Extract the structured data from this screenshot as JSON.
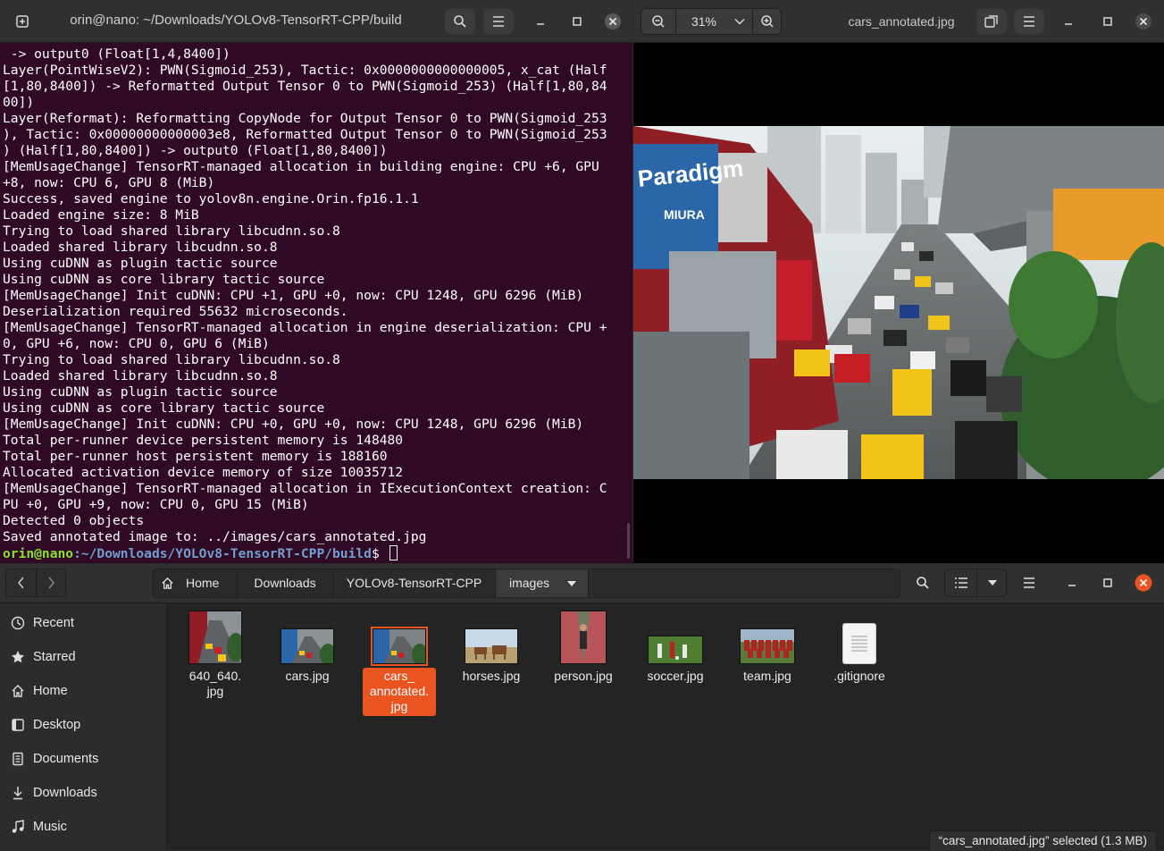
{
  "terminal": {
    "title": "orin@nano: ~/Downloads/YOLOv8-TensorRT-CPP/build",
    "lines": [
      " -> output0 (Float[1,4,8400])",
      "Layer(PointWiseV2): PWN(Sigmoid_253), Tactic: 0x0000000000000005, x_cat (Half",
      "[1,80,8400]) -> Reformatted Output Tensor 0 to PWN(Sigmoid_253) (Half[1,80,84",
      "00])",
      "Layer(Reformat): Reformatting CopyNode for Output Tensor 0 to PWN(Sigmoid_253",
      "), Tactic: 0x00000000000003e8, Reformatted Output Tensor 0 to PWN(Sigmoid_253",
      ") (Half[1,80,8400]) -> output0 (Float[1,80,8400])",
      "[MemUsageChange] TensorRT-managed allocation in building engine: CPU +6, GPU",
      "+8, now: CPU 6, GPU 8 (MiB)",
      "Success, saved engine to yolov8n.engine.Orin.fp16.1.1",
      "Loaded engine size: 8 MiB",
      "Trying to load shared library libcudnn.so.8",
      "Loaded shared library libcudnn.so.8",
      "Using cuDNN as plugin tactic source",
      "Using cuDNN as core library tactic source",
      "[MemUsageChange] Init cuDNN: CPU +1, GPU +0, now: CPU 1248, GPU 6296 (MiB)",
      "Deserialization required 55632 microseconds.",
      "[MemUsageChange] TensorRT-managed allocation in engine deserialization: CPU +",
      "0, GPU +6, now: CPU 0, GPU 6 (MiB)",
      "Trying to load shared library libcudnn.so.8",
      "Loaded shared library libcudnn.so.8",
      "Using cuDNN as plugin tactic source",
      "Using cuDNN as core library tactic source",
      "[MemUsageChange] Init cuDNN: CPU +0, GPU +0, now: CPU 1248, GPU 6296 (MiB)",
      "Total per-runner device persistent memory is 148480",
      "Total per-runner host persistent memory is 188160",
      "Allocated activation device memory of size 10035712",
      "[MemUsageChange] TensorRT-managed allocation in IExecutionContext creation: C",
      "PU +0, GPU +9, now: CPU 0, GPU 15 (MiB)",
      "Detected 0 objects",
      "Saved annotated image to: ../images/cars_annotated.jpg"
    ],
    "prompt_user": "orin@nano",
    "prompt_path": ":~/Downloads/YOLOv8-TensorRT-CPP/build",
    "prompt_symbol": "$ "
  },
  "viewer": {
    "zoom": "31%",
    "title": "cars_annotated.jpg"
  },
  "files": {
    "breadcrumbs": [
      "Home",
      "Downloads",
      "YOLOv8-TensorRT-CPP",
      "images"
    ],
    "sidebar": [
      "Recent",
      "Starred",
      "Home",
      "Desktop",
      "Documents",
      "Downloads",
      "Music"
    ],
    "items": [
      {
        "name": "640_640.\njpg",
        "selected": false
      },
      {
        "name": "cars.jpg",
        "selected": false
      },
      {
        "name": "cars_\nannotated.\njpg",
        "selected": true
      },
      {
        "name": "horses.jpg",
        "selected": false
      },
      {
        "name": "person.jpg",
        "selected": false
      },
      {
        "name": "soccer.jpg",
        "selected": false
      },
      {
        "name": "team.jpg",
        "selected": false
      },
      {
        "name": ".gitignore",
        "selected": false
      }
    ],
    "status": "“cars_annotated.jpg” selected (1.3 MB)"
  },
  "colors": {
    "terminal_bg": "#300a24",
    "accent": "#e95420",
    "prompt_user": "#8ae234",
    "prompt_path": "#729fcf"
  }
}
